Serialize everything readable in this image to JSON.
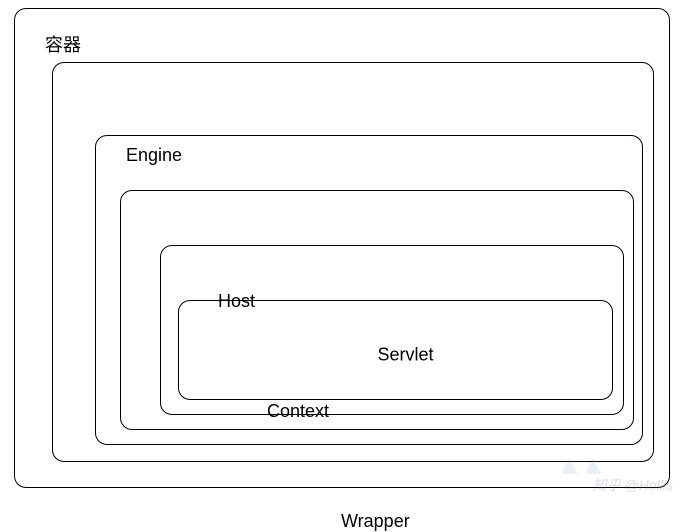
{
  "diagram": {
    "container": "容器",
    "engine": "Engine",
    "host": "Host",
    "context": "Context",
    "wrapper": "Wrapper",
    "servlet": "Servlet"
  },
  "watermark": {
    "text": "知乎 @Hollis"
  }
}
